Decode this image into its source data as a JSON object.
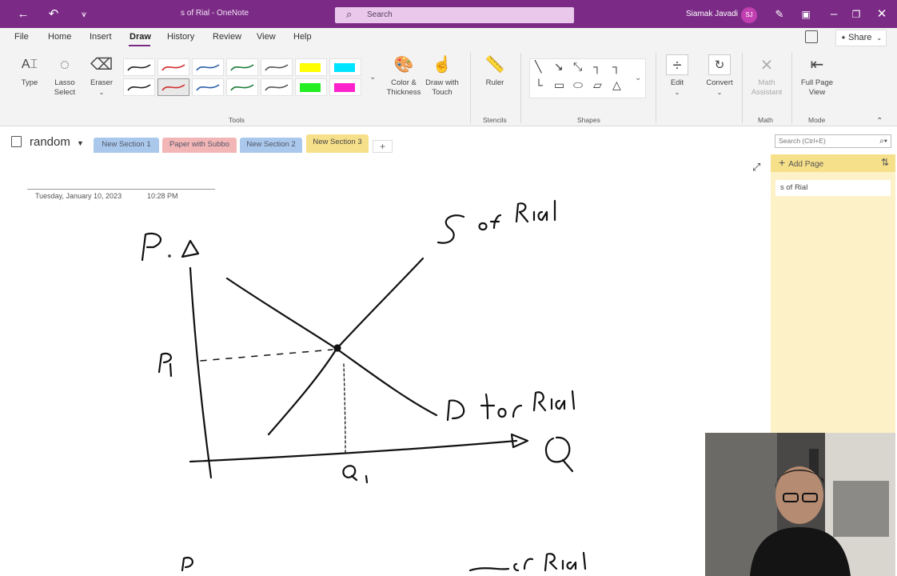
{
  "titlebar": {
    "doc_title": "s of Rial  -  OneNote",
    "search_placeholder": "Search",
    "user_name": "Siamak Javadi",
    "user_initials": "SJ",
    "color": "#7b2b86"
  },
  "menu": {
    "items": [
      "File",
      "Home",
      "Insert",
      "Draw",
      "History",
      "Review",
      "View",
      "Help"
    ],
    "active": "Draw",
    "share_label": "Share"
  },
  "ribbon": {
    "type_label": "Type",
    "lasso_label": "Lasso Select",
    "eraser_label": "Eraser",
    "color_thickness_label": "Color & Thickness",
    "draw_touch_label": "Draw with Touch",
    "ruler_label": "Ruler",
    "edit_label": "Edit",
    "convert_label": "Convert",
    "math_assistant_label": "Math Assistant",
    "full_page_label": "Full Page View",
    "groups": {
      "tools": "Tools",
      "stencils": "Stencils",
      "shapes": "Shapes",
      "math": "Math",
      "mode": "Mode"
    },
    "pen_colors": [
      "#222222",
      "#d12c2c",
      "#2b5fa8",
      "#1b7a3a",
      "#555555",
      "#ffff00",
      "#00e5ff",
      "#222222",
      "#d12c2c",
      "#2b5fa8",
      "#1b7a3a",
      "#555555",
      "#22ee22",
      "#ff22cc"
    ]
  },
  "sections": {
    "notebook_name": "random",
    "tabs": [
      {
        "label": "New Section 1",
        "color": "#a9c8ec"
      },
      {
        "label": "Paper with Subbo",
        "color": "#f2b6b6"
      },
      {
        "label": "New Section 2",
        "color": "#a9c8ec"
      },
      {
        "label": "New Section 3",
        "color": "#f7e08a"
      }
    ],
    "active_tab": "New Section 3",
    "search_placeholder": "Search (Ctrl+E)"
  },
  "page": {
    "date": "Tuesday, January 10, 2023",
    "time": "10:28 PM"
  },
  "pane": {
    "add_page_label": "Add Page",
    "pages": [
      "s of Rial"
    ]
  }
}
